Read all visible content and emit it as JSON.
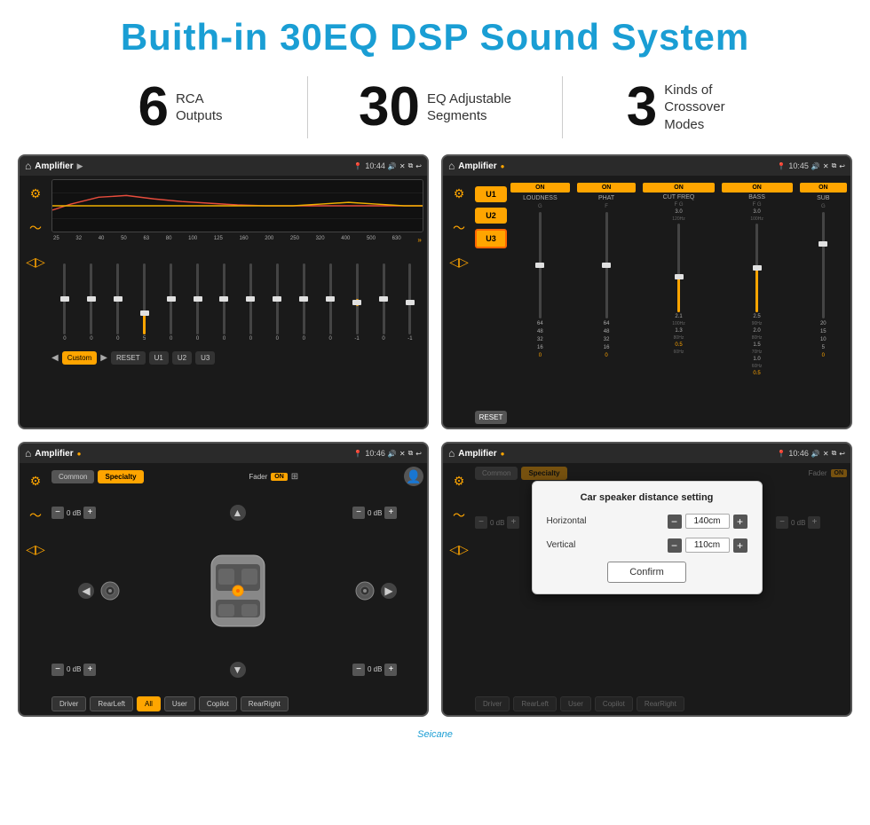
{
  "header": {
    "title": "Buith-in 30EQ DSP Sound System"
  },
  "stats": [
    {
      "number": "6",
      "label": "RCA\nOutputs"
    },
    {
      "number": "30",
      "label": "EQ Adjustable\nSegments"
    },
    {
      "number": "3",
      "label": "Kinds of\nCrossover Modes"
    }
  ],
  "screens": [
    {
      "id": "eq",
      "statusBar": {
        "appTitle": "Amplifier",
        "time": "10:44"
      },
      "freqLabels": [
        "25",
        "32",
        "40",
        "50",
        "63",
        "80",
        "100",
        "125",
        "160",
        "200",
        "250",
        "320",
        "400",
        "500",
        "630"
      ],
      "sliderValues": [
        "0",
        "0",
        "0",
        "5",
        "0",
        "0",
        "0",
        "0",
        "0",
        "0",
        "0",
        "-1",
        "0",
        "-1"
      ],
      "buttons": [
        "Custom",
        "RESET",
        "U1",
        "U2",
        "U3"
      ]
    },
    {
      "id": "amp",
      "statusBar": {
        "appTitle": "Amplifier",
        "time": "10:45"
      },
      "presets": [
        "U1",
        "U2",
        "U3"
      ],
      "channels": [
        {
          "toggle": "ON",
          "label": "LOUDNESS"
        },
        {
          "toggle": "ON",
          "label": "PHAT"
        },
        {
          "toggle": "ON",
          "label": "CUT FREQ"
        },
        {
          "toggle": "ON",
          "label": "BASS"
        },
        {
          "toggle": "ON",
          "label": "SUB"
        }
      ]
    },
    {
      "id": "common",
      "statusBar": {
        "appTitle": "Amplifier",
        "time": "10:46"
      },
      "tabs": [
        "Common",
        "Specialty"
      ],
      "faderLabel": "Fader",
      "dbValues": [
        "0 dB",
        "0 dB",
        "0 dB",
        "0 dB"
      ],
      "locationButtons": [
        "Driver",
        "RearLeft",
        "All",
        "User",
        "Copilot",
        "RearRight"
      ]
    },
    {
      "id": "dialog",
      "statusBar": {
        "appTitle": "Amplifier",
        "time": "10:46"
      },
      "tabs": [
        "Common",
        "Specialty"
      ],
      "dialog": {
        "title": "Car speaker distance setting",
        "rows": [
          {
            "label": "Horizontal",
            "value": "140cm"
          },
          {
            "label": "Vertical",
            "value": "110cm"
          }
        ],
        "confirmLabel": "Confirm",
        "dbValues": [
          "0 dB",
          "0 dB"
        ]
      },
      "locationButtons": [
        "Driver",
        "RearLeft",
        "User",
        "Copilot",
        "RearRight"
      ]
    }
  ],
  "watermark": "Seicane"
}
